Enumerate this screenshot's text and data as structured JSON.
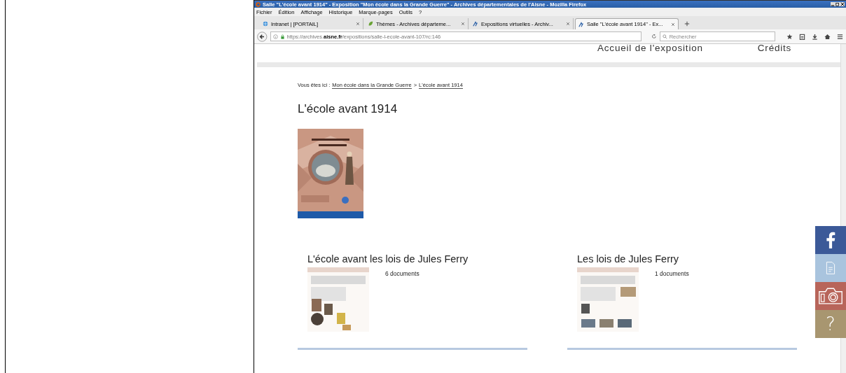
{
  "window": {
    "title": "Salle \"L'école avant 1914\" - Exposition \"Mon école dans la Grande Guerre\" - Archives départementales de l'Aisne - Mozilla Firefox"
  },
  "menu": [
    "Fichier",
    "Édition",
    "Affichage",
    "Historique",
    "Marque-pages",
    "Outils",
    "?"
  ],
  "tabs": [
    {
      "label": "Intranet | [PORTAIL]",
      "selected": false,
      "kind": "globe"
    },
    {
      "label": "Thèmes - Archives départeme...",
      "selected": false,
      "kind": "leaf"
    },
    {
      "label": "Expositions virtuelles - Archiv...",
      "selected": false,
      "kind": "logo"
    },
    {
      "label": "Salle \"L'école avant 1914\" - Ex...",
      "selected": true,
      "kind": "logo"
    }
  ],
  "address": {
    "url": "https://archives.**aisne.fr**/expositions/salle-l-ecole-avant-107/rc:146"
  },
  "search": {
    "placeholder": "Rechercher"
  },
  "nav": [
    "Accueil de l'exposition",
    "Crédits"
  ],
  "breadcrumb": {
    "prefix": "Vous êtes ici :",
    "links": [
      "Mon école dans la Grande Guerre",
      "L'école avant 1914"
    ],
    "separator": ">"
  },
  "page_title": "L'école avant 1914",
  "rooms": [
    {
      "title": "L'école avant les lois de Jules Ferry",
      "count": "6 documents"
    },
    {
      "title": "Les lois de Jules Ferry",
      "count": "1 documents"
    }
  ],
  "side_buttons": [
    {
      "kind": "facebook"
    },
    {
      "kind": "document"
    },
    {
      "kind": "camera"
    },
    {
      "kind": "help",
      "label": "?"
    }
  ]
}
